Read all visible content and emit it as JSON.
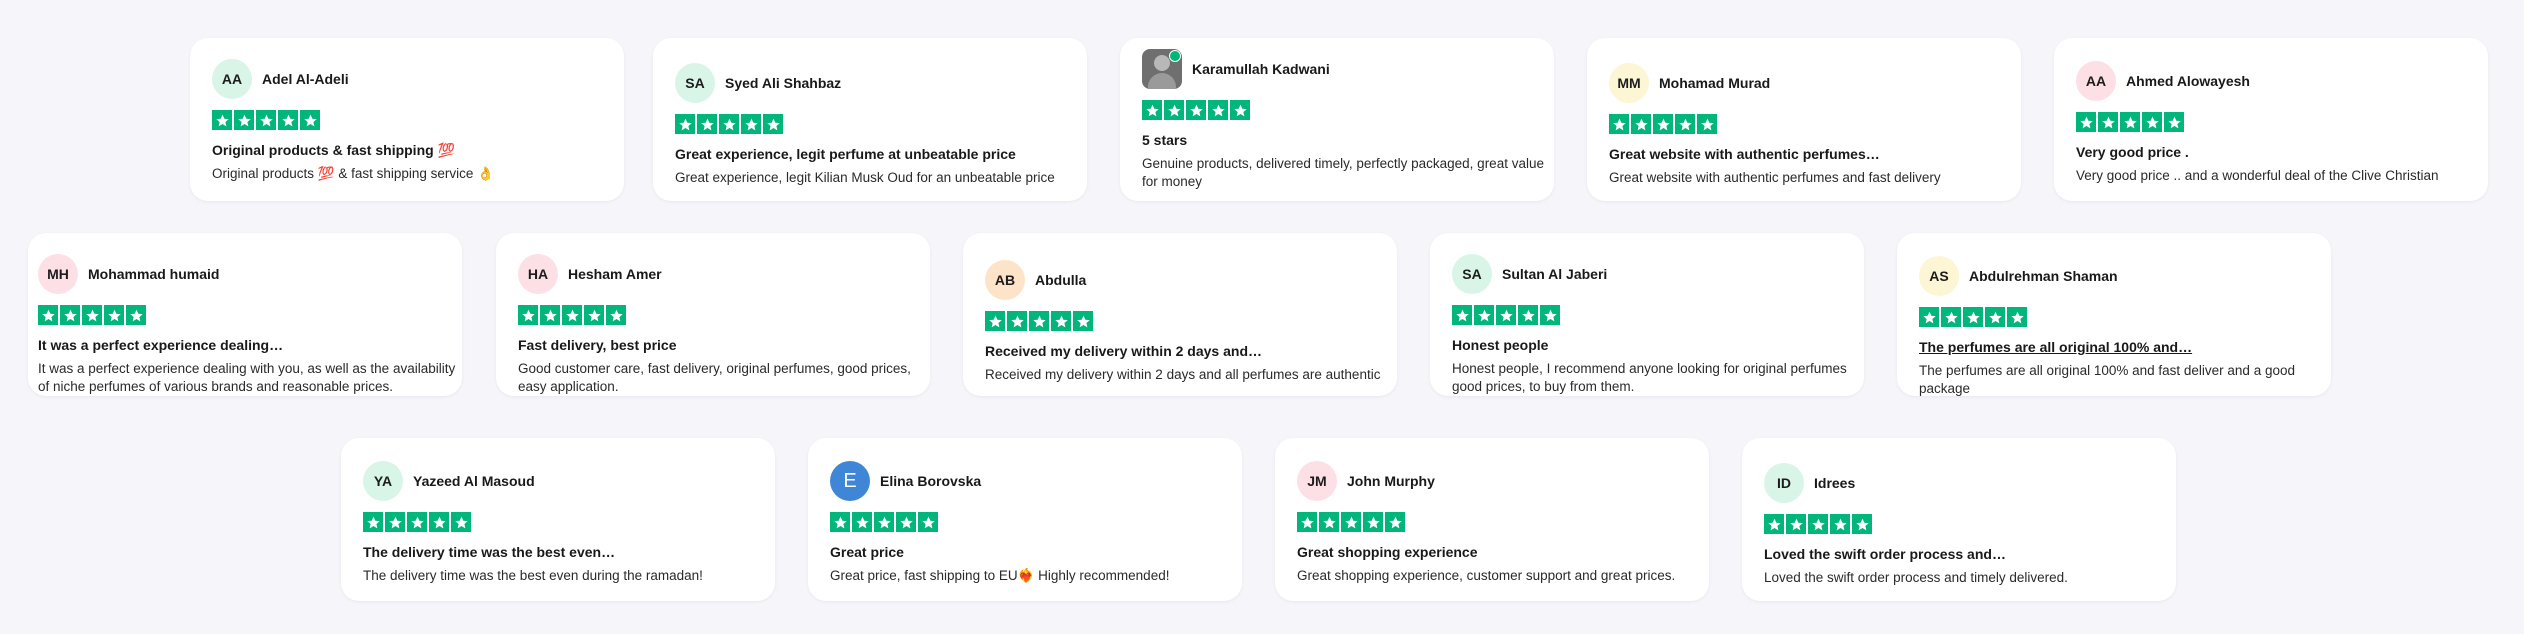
{
  "reviews": [
    {
      "initials": "AA",
      "name": "Adel Al-Adeli",
      "avatar_color": "#d8f5e8",
      "title": "Original products & fast shipping 💯",
      "body": "Original products 💯 & fast shipping service 👌",
      "rating": 5
    },
    {
      "initials": "SA",
      "name": "Syed Ali Shahbaz",
      "avatar_color": "#d8f5e8",
      "title": "Great experience, legit perfume at unbeatable price",
      "body": "Great experience, legit Kilian Musk Oud for an unbeatable price",
      "rating": 5
    },
    {
      "initials": "",
      "name": "Karamullah Kadwani",
      "avatar_color": "#6f6f6f",
      "title": "5 stars",
      "body": "Genuine products, delivered timely, perfectly packaged, great value for money",
      "rating": 5
    },
    {
      "initials": "MM",
      "name": "Mohamad Murad",
      "avatar_color": "#fcf6d4",
      "title": "Great website with authentic perfumes…",
      "body": "Great website with authentic perfumes and fast delivery",
      "rating": 5
    },
    {
      "initials": "AA",
      "name": "Ahmed Alowayesh",
      "avatar_color": "#fde0e6",
      "title": "Very good price .",
      "body": "Very good price .. and a wonderful deal of the Clive Christian",
      "rating": 5
    },
    {
      "initials": "MH",
      "name": "Mohammad humaid",
      "avatar_color": "#fde0e6",
      "title": "It was a perfect experience dealing…",
      "body": "It was a perfect experience dealing with you, as well as the availability of niche perfumes of various brands and reasonable prices.",
      "rating": 5
    },
    {
      "initials": "HA",
      "name": "Hesham Amer",
      "avatar_color": "#fde0e6",
      "title": "Fast delivery, best price",
      "body": "Good customer care, fast delivery, original perfumes, good prices, easy application.",
      "rating": 5
    },
    {
      "initials": "AB",
      "name": "Abdulla",
      "avatar_color": "#fde3c8",
      "title": "Received my delivery within 2 days and…",
      "body": "Received my delivery within 2 days and all perfumes are authentic",
      "rating": 5
    },
    {
      "initials": "SA",
      "name": "Sultan Al Jaberi",
      "avatar_color": "#d8f5e8",
      "title": "Honest people",
      "body": "Honest people, I recommend anyone looking for original perfumes good prices, to buy from them.",
      "rating": 5
    },
    {
      "initials": "AS",
      "name": "Abdulrehman Shaman",
      "avatar_color": "#fcf6d4",
      "title": "The perfumes are all original 100% and…",
      "body": "The perfumes are all original 100% and fast deliver and a good package",
      "rating": 5
    },
    {
      "initials": "YA",
      "name": "Yazeed Al Masoud",
      "avatar_color": "#d8f5e8",
      "title": "The delivery time was the best even…",
      "body": "The delivery time was the best even during the ramadan!",
      "rating": 5
    },
    {
      "initials": "E",
      "name": "Elina Borovska",
      "avatar_color": "#3f86d6",
      "title": "Great price",
      "body": "Great price, fast shipping to EU❤️‍🔥 Highly recommended!",
      "rating": 5
    },
    {
      "initials": "JM",
      "name": "John Murphy",
      "avatar_color": "#fde0e6",
      "title": "Great shopping experience",
      "body": "Great shopping experience, customer support and great prices.",
      "rating": 5
    },
    {
      "initials": "ID",
      "name": "Idrees",
      "avatar_color": "#d8f5e8",
      "title": "Loved the swift order process and…",
      "body": "Loved the swift order process and timely delivered.",
      "rating": 5
    }
  ],
  "colors": {
    "star": "#00b67a",
    "background": "#f5f5fa",
    "card": "#ffffff"
  }
}
